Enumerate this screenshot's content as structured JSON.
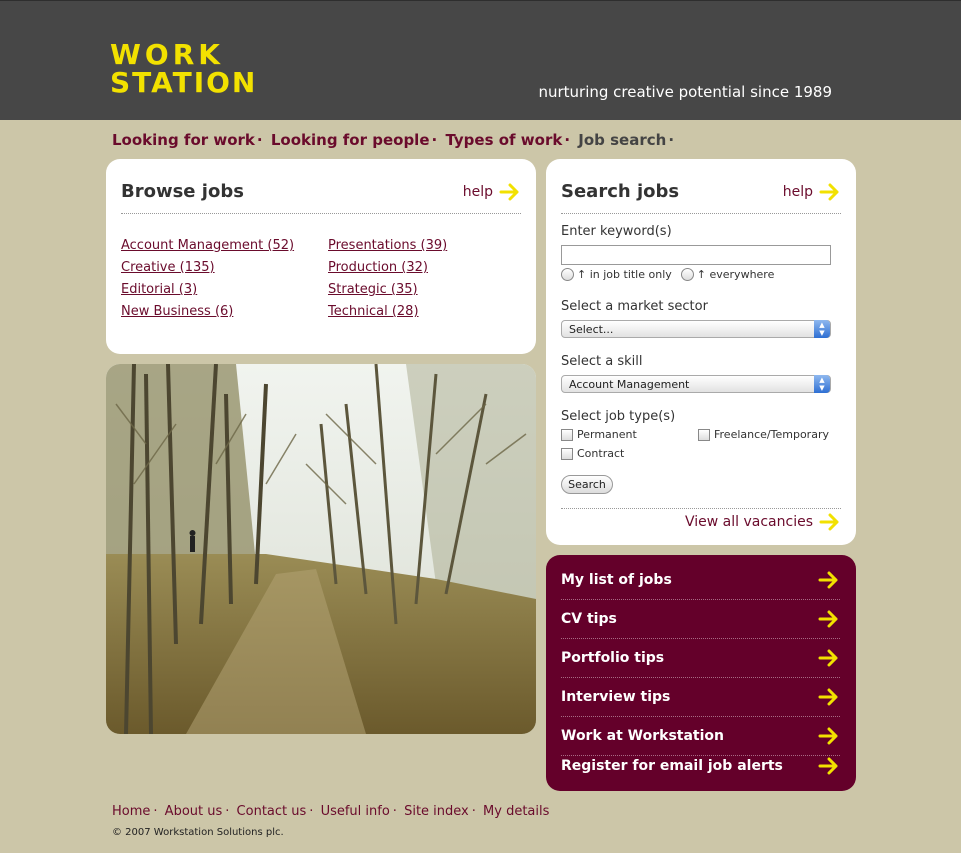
{
  "header": {
    "logo_line1": "work",
    "logo_line2": "station",
    "tagline": "nurturing creative potential since 1989"
  },
  "main_nav": [
    {
      "label": "Looking for work"
    },
    {
      "label": "Looking for people"
    },
    {
      "label": "Types of work"
    },
    {
      "label": "Job search"
    }
  ],
  "browse": {
    "title": "Browse jobs",
    "help": "help",
    "categories": [
      {
        "label": "Account Management (52)"
      },
      {
        "label": "Presentations (39)"
      },
      {
        "label": "Creative (135)"
      },
      {
        "label": "Production (32)"
      },
      {
        "label": "Editorial (3)"
      },
      {
        "label": "Strategic (35)"
      },
      {
        "label": "New Business (6)"
      },
      {
        "label": "Technical (28)"
      }
    ]
  },
  "search": {
    "title": "Search jobs",
    "help": "help",
    "keyword_label": "Enter keyword(s)",
    "keyword_value": "",
    "radio_title_only": "↑ in job title only",
    "radio_everywhere": "↑ everywhere",
    "sector_label": "Select a market sector",
    "sector_value": "Select...",
    "skill_label": "Select a skill",
    "skill_value": "Account Management",
    "jobtype_label": "Select job type(s)",
    "jobtypes": [
      "Permanent",
      "Freelance/Temporary",
      "Contract"
    ],
    "search_button": "Search",
    "view_all": "View all vacancies"
  },
  "quick_links": [
    {
      "label": "My list of jobs"
    },
    {
      "label": "CV tips"
    },
    {
      "label": "Portfolio tips"
    },
    {
      "label": "Interview tips"
    },
    {
      "label": "Work at Workstation"
    },
    {
      "label": "Register for email job alerts"
    }
  ],
  "footer": {
    "links": [
      "Home",
      "About us",
      "Contact us",
      "Useful info",
      "Site index",
      "My details"
    ],
    "copyright": "© 2007 Workstation Solutions plc."
  },
  "colors": {
    "header_bg": "#474747",
    "logo": "#f2e100",
    "page_bg": "#ccc6a8",
    "accent": "#6a0b2c",
    "links_panel": "#64002a",
    "arrow": "#f2e100"
  }
}
